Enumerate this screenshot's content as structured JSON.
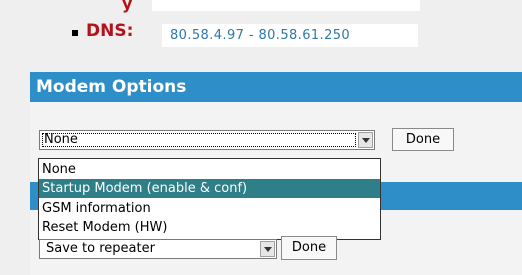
{
  "network": {
    "clipped_label": "y",
    "dns_label": "DNS:",
    "dns_value": "80.58.4.97 - 80.58.61.250"
  },
  "modem_options": {
    "title": "Modem Options",
    "select_value": "None",
    "done_label": "Done",
    "options": [
      "None",
      "Startup Modem (enable & conf)",
      "GSM information",
      "Reset Modem (HW)"
    ],
    "highlighted_option": "Startup Modem (enable & conf)"
  },
  "repeater": {
    "select_value": "Save to repeater",
    "done_label": "Done"
  },
  "colors": {
    "header_blue": "#2e8fc8",
    "highlight_teal": "#2f7f88",
    "dns_red": "#b3121b",
    "dns_value_blue": "#2f78a8"
  }
}
